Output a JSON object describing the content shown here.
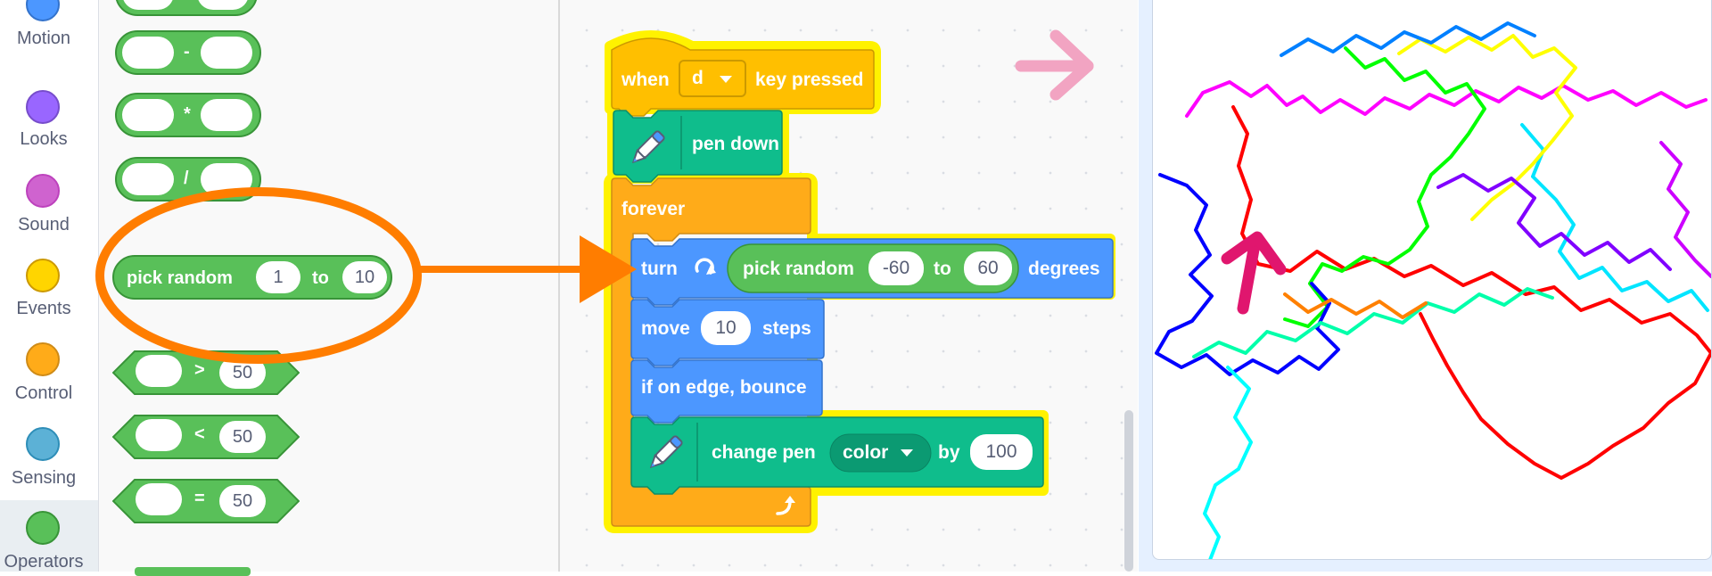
{
  "categories": [
    {
      "label": "Motion",
      "color": "#4c97ff",
      "border": "#3373cc"
    },
    {
      "label": "Looks",
      "color": "#9966ff",
      "border": "#774dcb"
    },
    {
      "label": "Sound",
      "color": "#cf63cf",
      "border": "#bd42bd"
    },
    {
      "label": "Events",
      "color": "#ffd500",
      "border": "#cc9900"
    },
    {
      "label": "Control",
      "color": "#ffab19",
      "border": "#cf8b17"
    },
    {
      "label": "Sensing",
      "color": "#5cb1d6",
      "border": "#2e8eb8"
    },
    {
      "label": "Operators",
      "color": "#59c059",
      "border": "#389438",
      "selected": true
    }
  ],
  "palette": {
    "ops": [
      "-",
      "*",
      "/"
    ],
    "pick_random": {
      "label": "pick random",
      "from": "1",
      "to_label": "to",
      "to": "10"
    },
    "comparisons": [
      {
        "op": ">",
        "value": "50"
      },
      {
        "op": "<",
        "value": "50"
      },
      {
        "op": "=",
        "value": "50"
      }
    ]
  },
  "script": {
    "hat": {
      "when": "when",
      "key": "d",
      "suffix": "key pressed"
    },
    "pen_down": "pen down",
    "forever": "forever",
    "turn": {
      "label": "turn",
      "pick_random": "pick random",
      "from": "-60",
      "to_label": "to",
      "to": "60",
      "suffix": "degrees"
    },
    "move": {
      "label": "move",
      "value": "10",
      "suffix": "steps"
    },
    "bounce": "if on edge, bounce",
    "change_pen": {
      "label": "change pen",
      "param": "color",
      "by_label": "by",
      "value": "100"
    }
  },
  "colors": {
    "operators": "#59c059",
    "motion": "#4c97ff",
    "control": "#ffab19",
    "events": "#ffbf00",
    "pen": "#0fbd8c",
    "highlight": "#fff200",
    "annotation_orange": "#ff7d00",
    "annotation_pink": "#f2a4c2",
    "sprite_arrow": "#e0166e"
  },
  "icons": [
    "pen-icon",
    "rotate-right-icon",
    "dropdown-caret-icon",
    "loop-arrow-icon",
    "right-arrow-icon",
    "up-arrow-icon"
  ]
}
